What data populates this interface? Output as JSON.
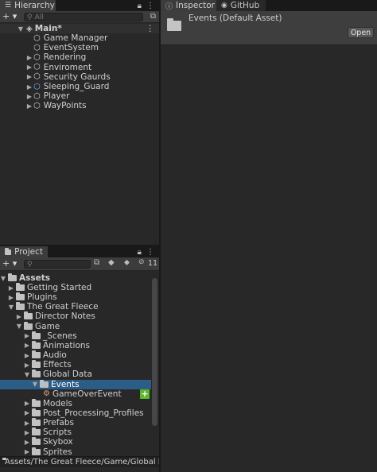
{
  "hierarchy": {
    "tab_label": "Hierarchy",
    "add_label": "+ ▾",
    "search_placeholder": "All",
    "scene_name": "Main*",
    "items": [
      {
        "label": "Game Manager",
        "expandable": false,
        "icon": "cube-icon"
      },
      {
        "label": "EventSystem",
        "expandable": false,
        "icon": "cube-icon"
      },
      {
        "label": "Rendering",
        "expandable": true,
        "icon": "cube-icon"
      },
      {
        "label": "Enviroment",
        "expandable": true,
        "icon": "cube-icon"
      },
      {
        "label": "Security Gaurds",
        "expandable": true,
        "icon": "cube-icon"
      },
      {
        "label": "Sleeping_Guard",
        "expandable": true,
        "icon": "prefab-cube-icon"
      },
      {
        "label": "Player",
        "expandable": true,
        "icon": "cube-icon"
      },
      {
        "label": "WayPoints",
        "expandable": true,
        "icon": "cube-icon"
      }
    ]
  },
  "inspector": {
    "tab_label": "Inspector",
    "github_tab_label": "GitHub",
    "asset_title": "Events (Default Asset)",
    "open_button": "Open"
  },
  "project": {
    "tab_label": "Project",
    "add_label": "+ ▾",
    "hidden_count": "11",
    "root_label": "Assets",
    "tree": [
      {
        "label": "Getting Started",
        "level": 1,
        "state": "collapsed"
      },
      {
        "label": "Plugins",
        "level": 1,
        "state": "collapsed"
      },
      {
        "label": "The Great Fleece",
        "level": 1,
        "state": "expanded"
      },
      {
        "label": "Director Notes",
        "level": 2,
        "state": "collapsed"
      },
      {
        "label": "Game",
        "level": 2,
        "state": "expanded"
      },
      {
        "label": "_Scenes",
        "level": 3,
        "state": "collapsed"
      },
      {
        "label": "Animations",
        "level": 3,
        "state": "collapsed"
      },
      {
        "label": "Audio",
        "level": 3,
        "state": "collapsed"
      },
      {
        "label": "Effects",
        "level": 3,
        "state": "collapsed"
      },
      {
        "label": "Global Data",
        "level": 3,
        "state": "expanded"
      },
      {
        "label": "Events",
        "level": 4,
        "state": "expanded",
        "selected": true
      },
      {
        "label": "GameOverEvent",
        "level": 5,
        "state": "file"
      },
      {
        "label": "Models",
        "level": 3,
        "state": "collapsed"
      },
      {
        "label": "Post_Processing_Profiles",
        "level": 3,
        "state": "collapsed"
      },
      {
        "label": "Prefabs",
        "level": 3,
        "state": "collapsed"
      },
      {
        "label": "Scripts",
        "level": 3,
        "state": "collapsed"
      },
      {
        "label": "Skybox",
        "level": 3,
        "state": "collapsed"
      },
      {
        "label": "Sprites",
        "level": 3,
        "state": "collapsed"
      }
    ],
    "footer_path": "Assets/The Great Fleece/Game/Global Data"
  },
  "colors": {
    "selection": "#2c5d87",
    "add_badge": "#5bb72b"
  }
}
